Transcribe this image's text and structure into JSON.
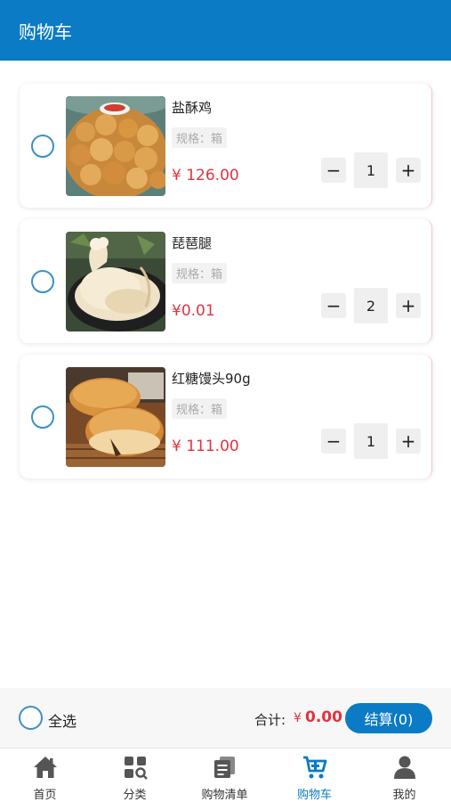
{
  "header": {
    "title": "购物车"
  },
  "cart": {
    "items": [
      {
        "name": "盐酥鸡",
        "spec": "规格：箱",
        "currency": "¥",
        "price": "126.00",
        "quantity": "1",
        "minus": "−",
        "plus": "+"
      },
      {
        "name": "琵琶腿",
        "spec": "规格：箱",
        "currency": "¥",
        "price": "0.01",
        "quantity": "2",
        "minus": "−",
        "plus": "+"
      },
      {
        "name": "红糖馒头90g",
        "spec": "规格：箱",
        "currency": "¥",
        "price": "111.00",
        "quantity": "1",
        "minus": "−",
        "plus": "+"
      }
    ]
  },
  "footer": {
    "select_all": "全选",
    "total_label": "合计:",
    "currency": "¥",
    "total": "0.00",
    "checkout": "结算(0)"
  },
  "tabbar": {
    "items": [
      {
        "label": "首页",
        "icon": "home-icon"
      },
      {
        "label": "分类",
        "icon": "category-icon"
      },
      {
        "label": "购物清单",
        "icon": "list-icon"
      },
      {
        "label": "购物车",
        "icon": "cart-icon"
      },
      {
        "label": "我的",
        "icon": "user-icon"
      }
    ],
    "active": 3
  },
  "colors": {
    "brand": "#0a7bc4",
    "price": "#e0343f",
    "radio": "#3a90c8"
  }
}
